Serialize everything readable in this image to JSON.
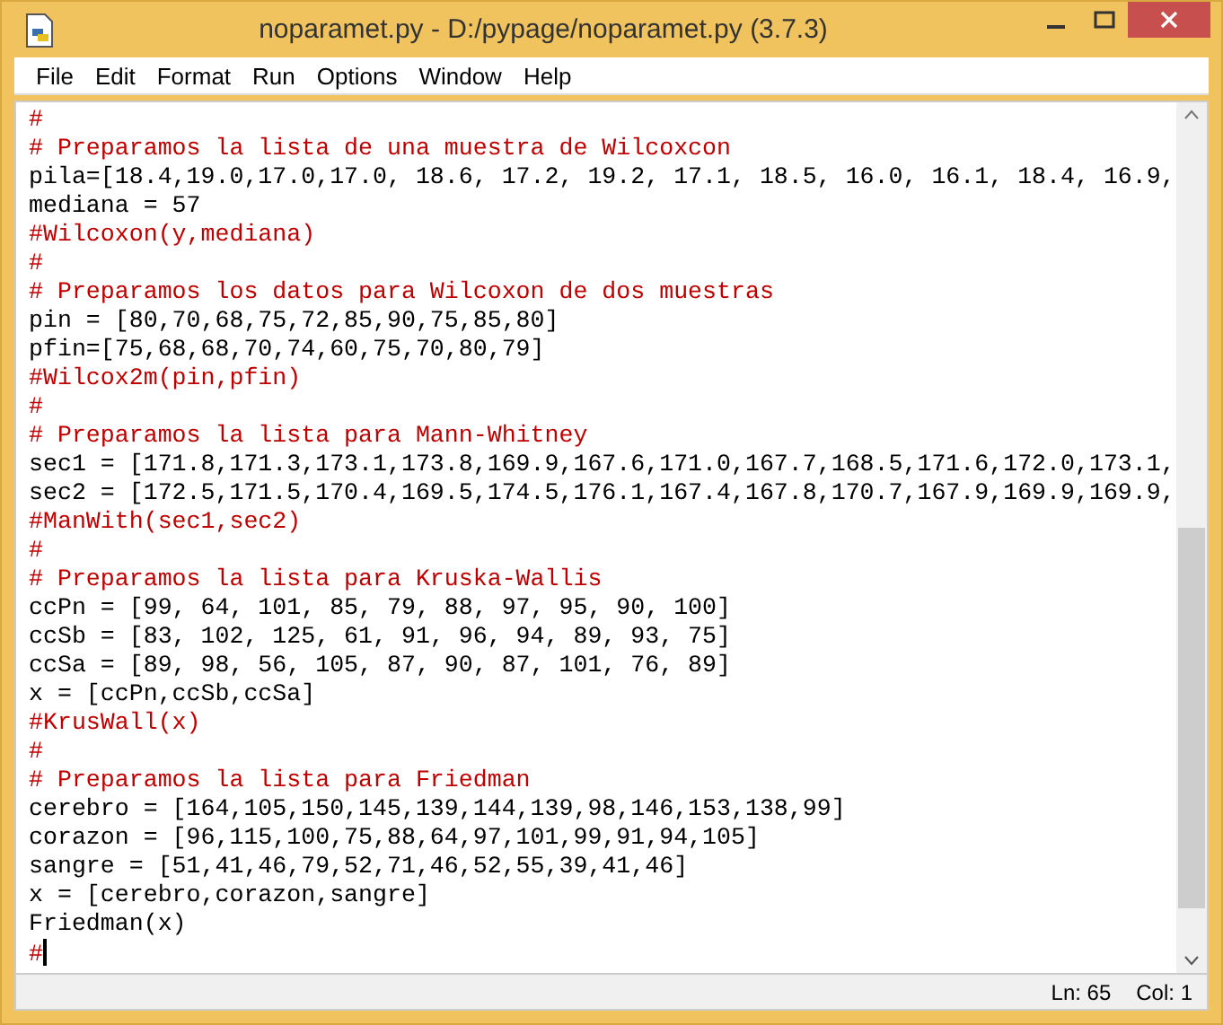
{
  "window": {
    "title": "noparamet.py - D:/pypage/noparamet.py (3.7.3)"
  },
  "menu": [
    "File",
    "Edit",
    "Format",
    "Run",
    "Options",
    "Window",
    "Help"
  ],
  "editor": {
    "lines": [
      {
        "kind": "comment",
        "text": "#"
      },
      {
        "kind": "comment",
        "text": "# Preparamos la lista de una muestra de Wilcoxcon"
      },
      {
        "kind": "code",
        "text": "pila=[18.4,19.0,17.0,17.0, 18.6, 17.2, 19.2, 17.1, 18.5, 16.0, 16.1, 18.4, 16.9,"
      },
      {
        "kind": "code",
        "text": "mediana = 57"
      },
      {
        "kind": "comment",
        "text": "#Wilcoxon(y,mediana)"
      },
      {
        "kind": "comment",
        "text": "#"
      },
      {
        "kind": "comment",
        "text": "# Preparamos los datos para Wilcoxon de dos muestras"
      },
      {
        "kind": "code",
        "text": "pin = [80,70,68,75,72,85,90,75,85,80]"
      },
      {
        "kind": "code",
        "text": "pfin=[75,68,68,70,74,60,75,70,80,79]"
      },
      {
        "kind": "comment",
        "text": "#Wilcox2m(pin,pfin)"
      },
      {
        "kind": "comment",
        "text": "#"
      },
      {
        "kind": "comment",
        "text": "# Preparamos la lista para Mann-Whitney"
      },
      {
        "kind": "code",
        "text": "sec1 = [171.8,171.3,173.1,173.8,169.9,167.6,171.0,167.7,168.5,171.6,172.0,173.1,"
      },
      {
        "kind": "code",
        "text": "sec2 = [172.5,171.5,170.4,169.5,174.5,176.1,167.4,167.8,170.7,167.9,169.9,169.9,"
      },
      {
        "kind": "comment",
        "text": "#ManWith(sec1,sec2)"
      },
      {
        "kind": "comment",
        "text": "#"
      },
      {
        "kind": "comment",
        "text": "# Preparamos la lista para Kruska-Wallis"
      },
      {
        "kind": "code",
        "text": "ccPn = [99, 64, 101, 85, 79, 88, 97, 95, 90, 100]"
      },
      {
        "kind": "code",
        "text": "ccSb = [83, 102, 125, 61, 91, 96, 94, 89, 93, 75]"
      },
      {
        "kind": "code",
        "text": "ccSa = [89, 98, 56, 105, 87, 90, 87, 101, 76, 89]"
      },
      {
        "kind": "code",
        "text": "x = [ccPn,ccSb,ccSa]"
      },
      {
        "kind": "comment",
        "text": "#KrusWall(x)"
      },
      {
        "kind": "comment",
        "text": "#"
      },
      {
        "kind": "comment",
        "text": "# Preparamos la lista para Friedman"
      },
      {
        "kind": "code",
        "text": "cerebro = [164,105,150,145,139,144,139,98,146,153,138,99]"
      },
      {
        "kind": "code",
        "text": "corazon = [96,115,100,75,88,64,97,101,99,91,94,105]"
      },
      {
        "kind": "code",
        "text": "sangre = [51,41,46,79,52,71,46,52,55,39,41,46]"
      },
      {
        "kind": "code",
        "text": "x = [cerebro,corazon,sangre]"
      },
      {
        "kind": "code",
        "text": "Friedman(x)"
      },
      {
        "kind": "comment",
        "text": "#",
        "cursor": true
      }
    ]
  },
  "status_bar": {
    "line": "Ln: 65",
    "column": "Col: 1"
  }
}
